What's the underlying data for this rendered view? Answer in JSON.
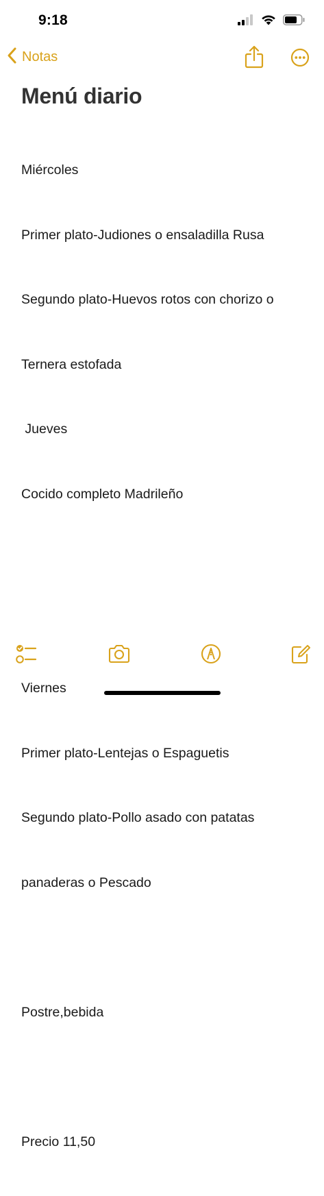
{
  "status_bar": {
    "time": "9:18",
    "icons": [
      "cellular-signal-icon",
      "wifi-icon",
      "battery-icon"
    ]
  },
  "nav": {
    "back_label": "Notas",
    "icons": [
      "chevron-left-icon",
      "share-icon",
      "more-icon"
    ]
  },
  "note": {
    "title": "Menú diario",
    "lines": [
      "Miércoles",
      "Primer plato-Judiones o ensaladilla Rusa",
      "Segundo plato-Huevos rotos con chorizo o",
      "Ternera estofada",
      " Jueves",
      "Cocido completo Madrileño",
      "",
      "",
      "Viernes",
      "Primer plato-Lentejas o Espaguetis",
      "Segundo plato-Pollo asado con patatas",
      "panaderas o Pescado",
      "",
      "Postre,bebida",
      "",
      "Precio 11,50"
    ]
  },
  "toolbar": {
    "icons": [
      "checklist-icon",
      "camera-icon",
      "markup-pen-icon",
      "compose-icon"
    ]
  },
  "colors": {
    "accent": "#D9A21B",
    "text": "#1a1a1a",
    "title": "#333333",
    "background": "#ffffff"
  }
}
